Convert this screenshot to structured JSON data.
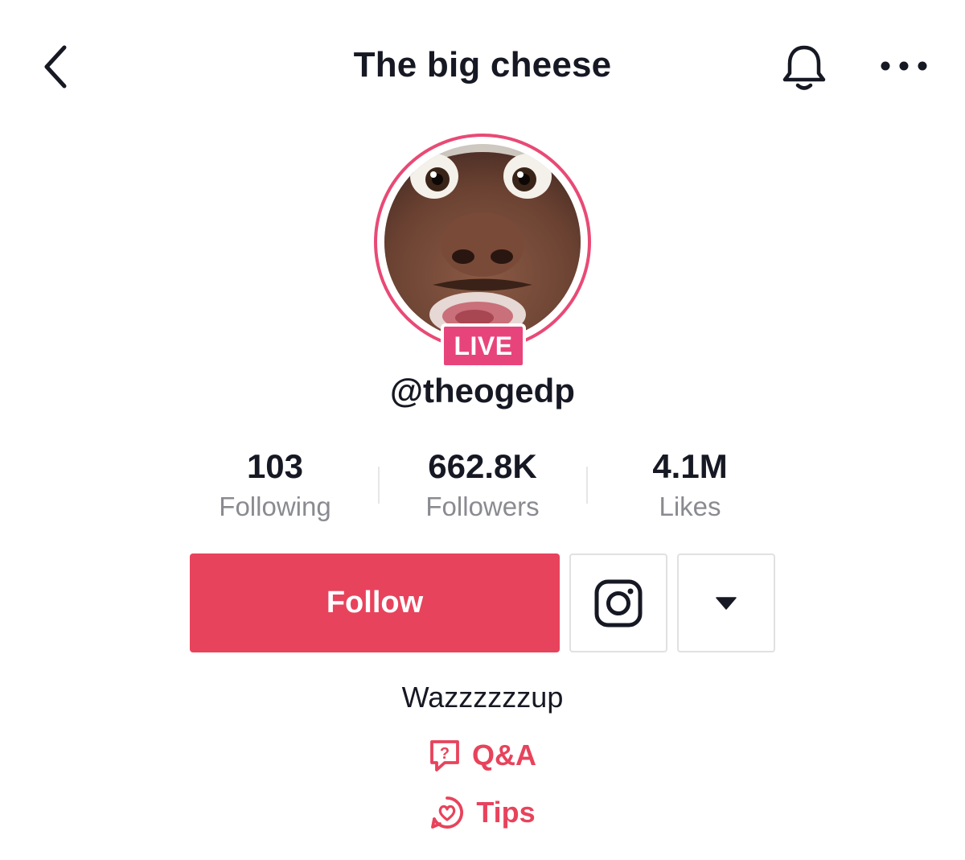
{
  "header": {
    "title": "The big cheese",
    "back_icon": "chevron-left-icon",
    "bell_icon": "bell-icon",
    "more_icon": "more-horizontal-icon"
  },
  "profile": {
    "live_badge": "LIVE",
    "username": "@theogedp",
    "bio": "Wazzzzzzup",
    "accent_color": "#e8435c",
    "ring_color": "#e84a75"
  },
  "stats": [
    {
      "value": "103",
      "label": "Following"
    },
    {
      "value": "662.8K",
      "label": "Followers"
    },
    {
      "value": "4.1M",
      "label": "Likes"
    }
  ],
  "actions": {
    "follow_label": "Follow",
    "instagram_icon": "instagram-icon",
    "dropdown_icon": "caret-down-icon"
  },
  "links": {
    "qa_label": "Q&A",
    "tips_label": "Tips"
  }
}
